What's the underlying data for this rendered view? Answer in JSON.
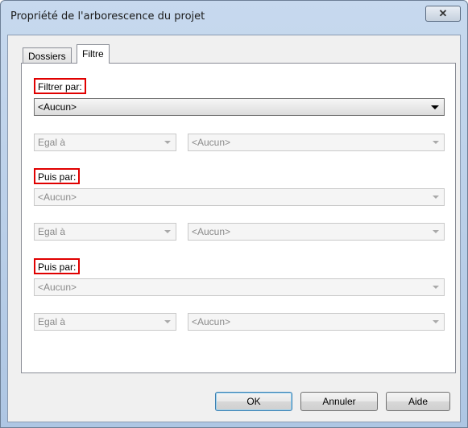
{
  "window": {
    "title": "Propriété de l'arborescence du projet",
    "close_glyph": "✕"
  },
  "tabs": [
    {
      "label": "Dossiers",
      "active": false
    },
    {
      "label": "Filtre",
      "active": true
    }
  ],
  "filter": {
    "sections": [
      {
        "label": "Filtrer par:",
        "field": {
          "value": "<Aucun>",
          "enabled": true
        },
        "operator": {
          "value": "Egal à",
          "enabled": false
        },
        "value": {
          "value": "<Aucun>",
          "enabled": false
        }
      },
      {
        "label": "Puis par:",
        "field": {
          "value": "<Aucun>",
          "enabled": false
        },
        "operator": {
          "value": "Egal à",
          "enabled": false
        },
        "value": {
          "value": "<Aucun>",
          "enabled": false
        }
      },
      {
        "label": "Puis par:",
        "field": {
          "value": "<Aucun>",
          "enabled": false
        },
        "operator": {
          "value": "Egal à",
          "enabled": false
        },
        "value": {
          "value": "<Aucun>",
          "enabled": false
        }
      }
    ]
  },
  "buttons": {
    "ok": "OK",
    "cancel": "Annuler",
    "help": "Aide"
  },
  "colors": {
    "highlight_box": "#e00000",
    "titlebar": "#c7d9ee"
  }
}
